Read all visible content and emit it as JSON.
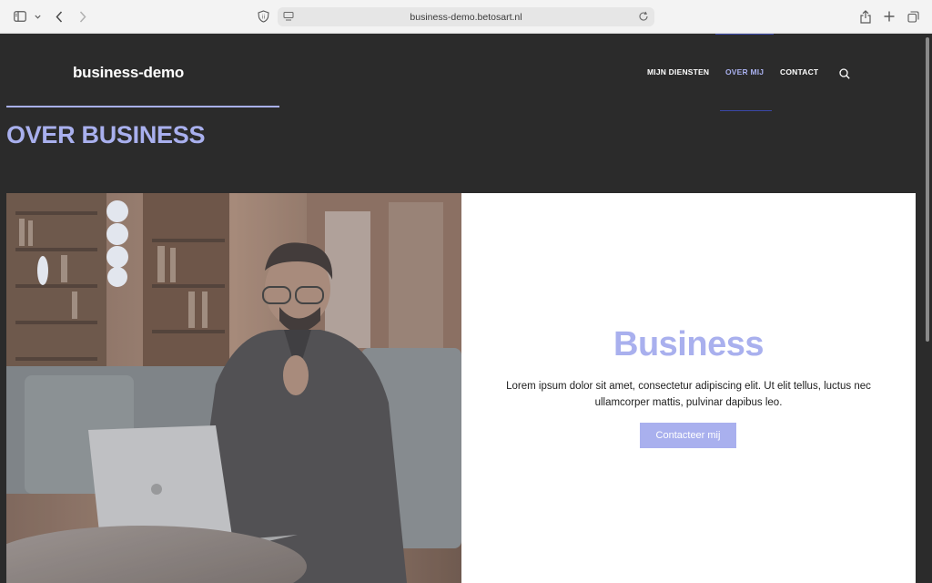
{
  "browser": {
    "url": "business-demo.betosart.nl",
    "icons": [
      "sidebar-icon",
      "chevron-down-icon",
      "back-icon",
      "forward-icon",
      "shield-icon",
      "site-settings-icon",
      "reload-icon",
      "share-icon",
      "new-tab-icon",
      "tabs-overview-icon"
    ]
  },
  "header": {
    "logo": "business-demo",
    "nav": [
      "MIJN DIENSTEN",
      "OVER MIJ",
      "CONTACT"
    ],
    "active_nav": "OVER MIJ",
    "search_icon": "search-icon"
  },
  "page": {
    "title": "OVER BUSINESS"
  },
  "hero": {
    "image_alt": "man with glasses at laptop in library",
    "heading": "Business",
    "text": "Lorem ipsum dolor sit amet, consectetur adipiscing elit. Ut elit tellus, luctus nec ullamcorper mattis, pulvinar dapibus leo.",
    "button": "Contacteer mij"
  },
  "colors": {
    "accent": "#a9b0ee",
    "background": "#2b2b2b",
    "panel": "#ffffff"
  }
}
